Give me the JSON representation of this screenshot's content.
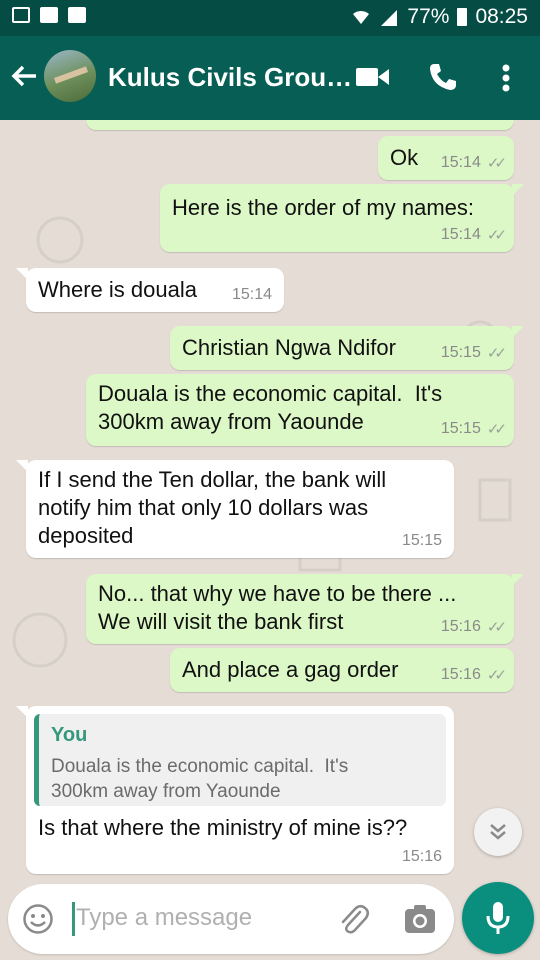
{
  "status_bar": {
    "battery": "77%",
    "time": "08:25"
  },
  "header": {
    "title": "Kulus Civils Grou…"
  },
  "messages": [
    {
      "text": "Ok",
      "time": "15:14"
    },
    {
      "text": "Here is the order of my names:",
      "time": "15:14"
    },
    {
      "text": "Where is douala",
      "time": "15:14"
    },
    {
      "text": "Christian Ngwa Ndifor",
      "time": "15:15"
    },
    {
      "text": "Douala is the economic capital.  It's\n300km away from Yaounde",
      "time": "15:15"
    },
    {
      "text": "If I send the Ten dollar, the bank will\nnotify him that only 10 dollars was\ndeposited",
      "time": "15:15"
    },
    {
      "text": "No... that why we have to be there ...\nWe will visit the bank first",
      "time": "15:16"
    },
    {
      "text": "And place a gag order",
      "time": "15:16"
    },
    {
      "text": "Is that where the ministry of mine is??",
      "time": "15:16",
      "quote": {
        "author": "You",
        "text": "Douala is the economic capital.  It's\n300km away from Yaounde"
      }
    }
  ],
  "composer": {
    "placeholder": "Type a message"
  },
  "colors": {
    "header": "#075e54",
    "status_bar": "#054d44",
    "outgoing": "#dcf8c6",
    "accent": "#35987c"
  }
}
